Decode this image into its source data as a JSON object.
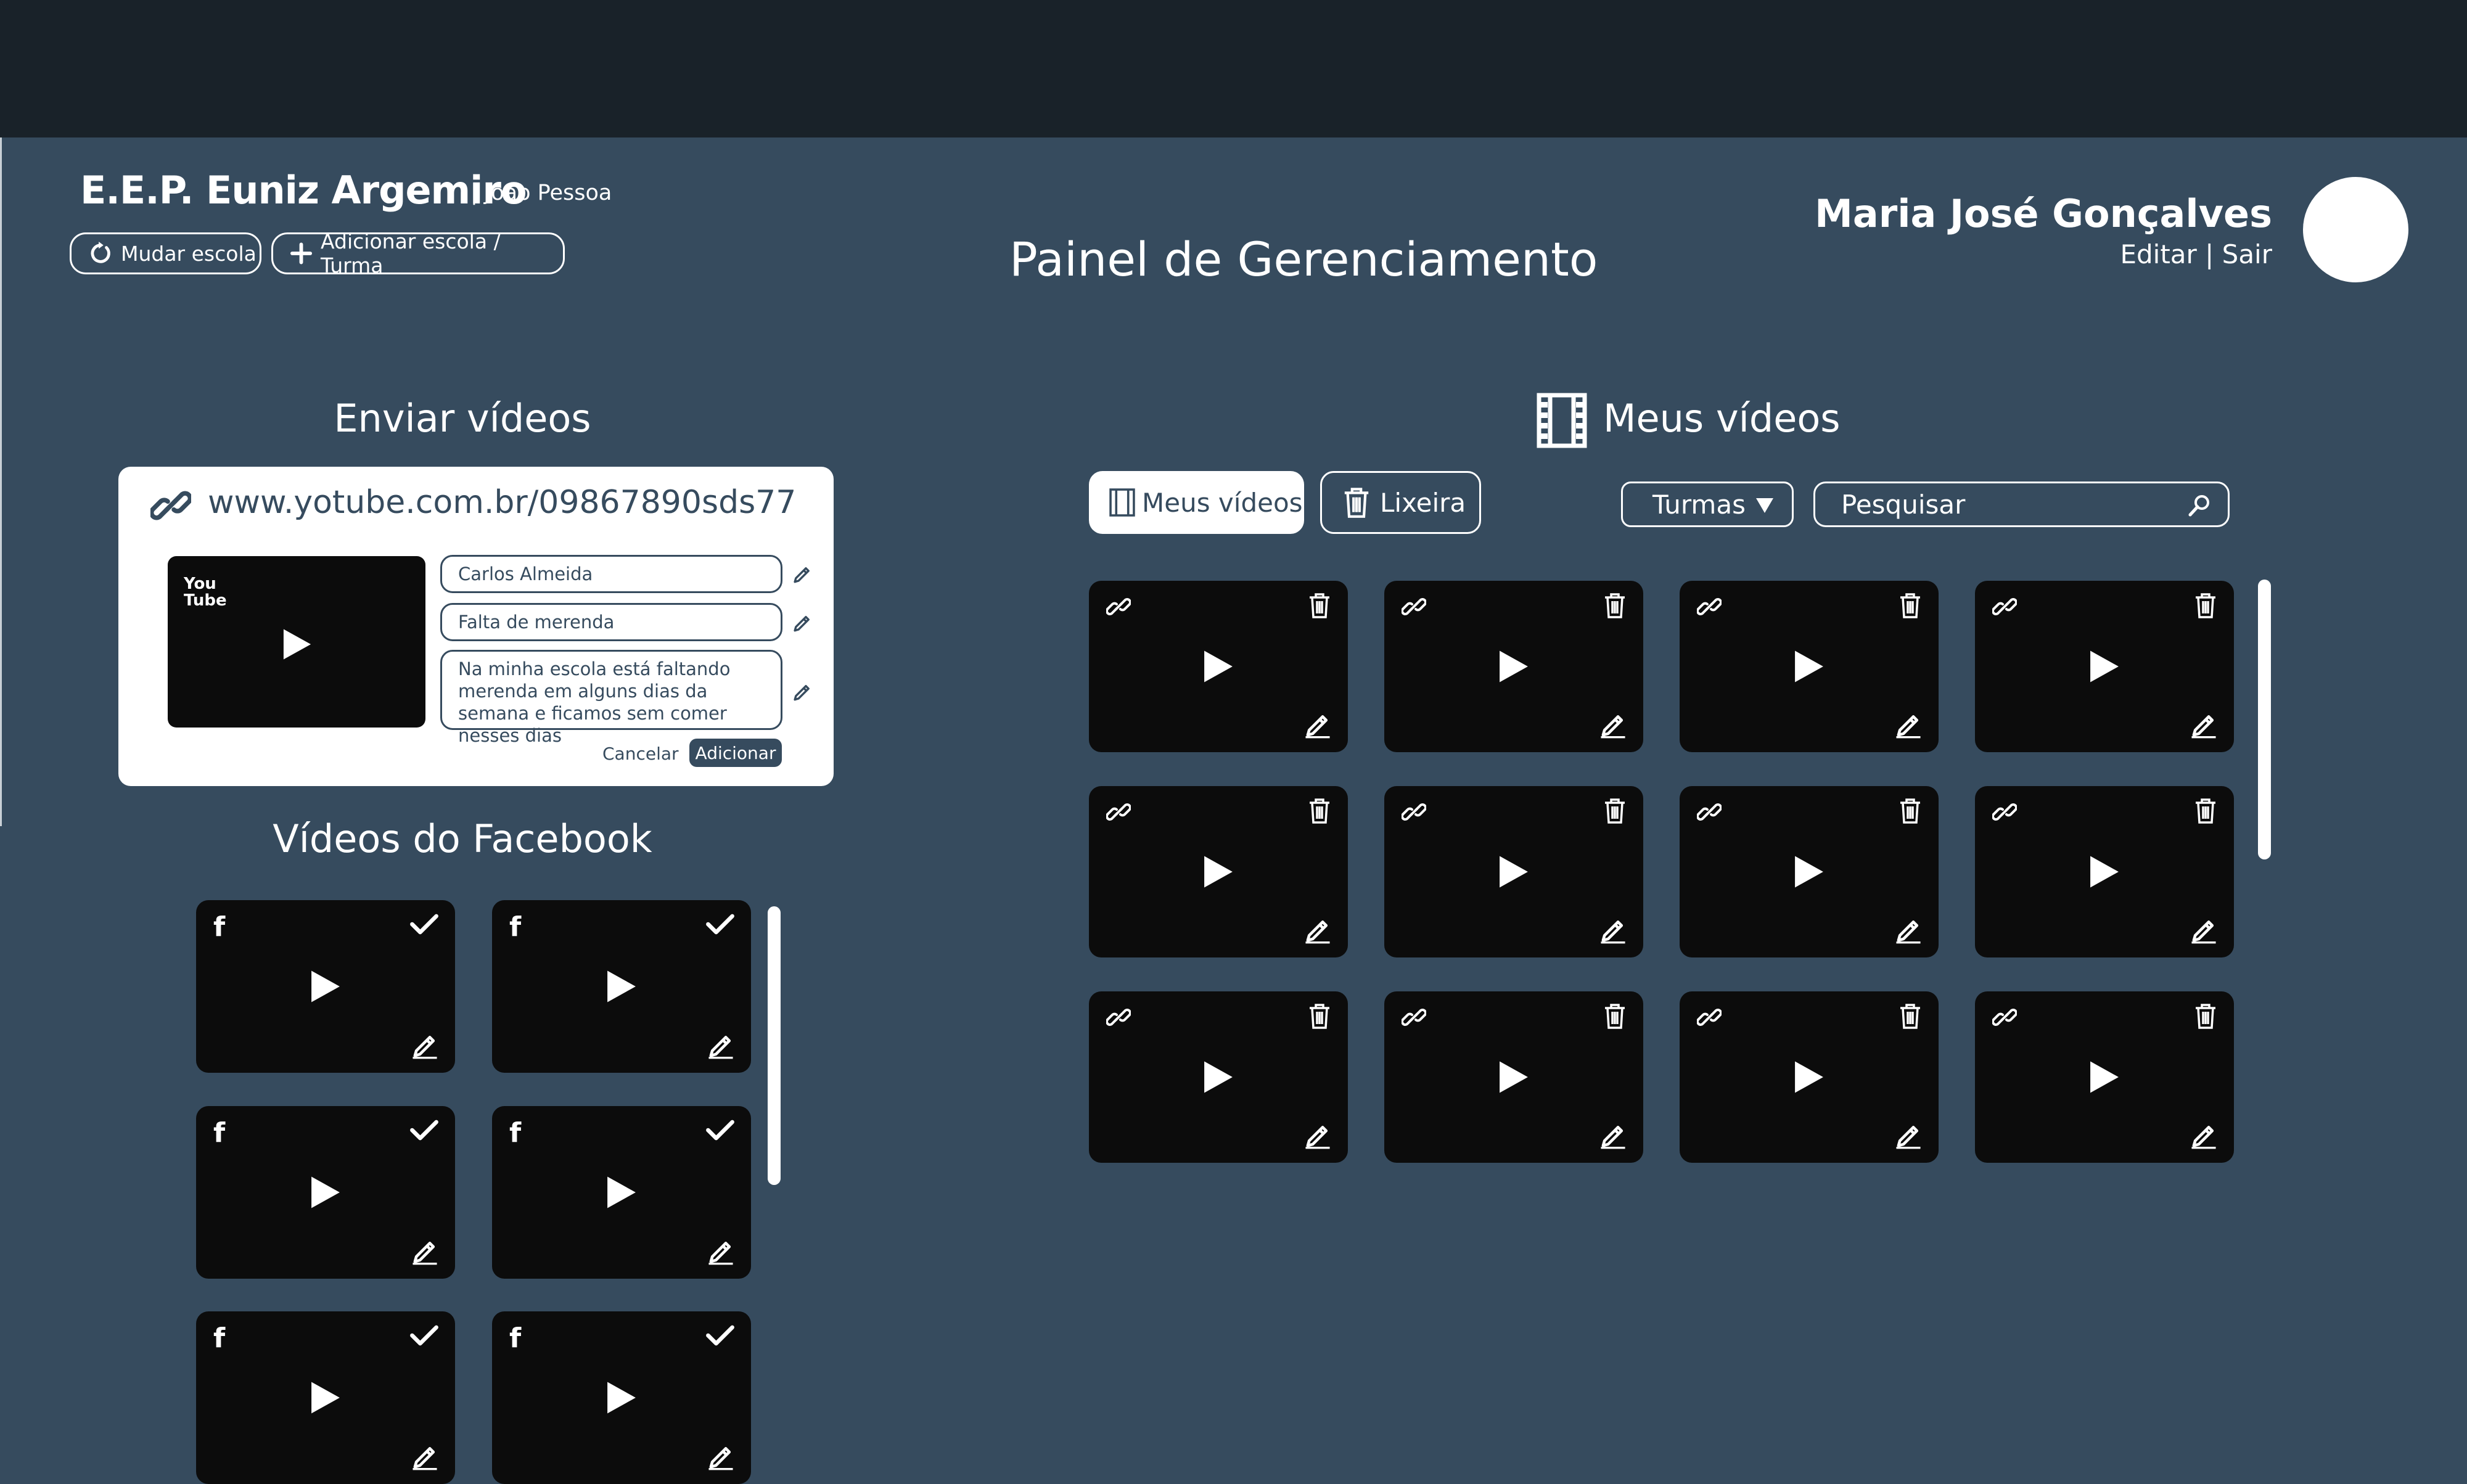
{
  "header": {
    "school_name": "E.E.P. Euniz Argemiro",
    "school_city": "| João Pessoa",
    "change_school": "Mudar escola",
    "add_school": "Adicionar escola / Turma",
    "panel_title": "Painel de Gerenciamento",
    "user_name": "Maria José Gonçalves",
    "user_links": "Editar | Sair"
  },
  "upload": {
    "title": "Enviar vídeos",
    "url": "www.yotube.com.br/09867890sds77",
    "thumb_logo": "You\nTube",
    "author": "Carlos Almeida",
    "subject": "Falta de merenda",
    "description": "Na minha escola está faltando merenda em alguns dias da semana e ficamos sem comer nesses dias",
    "cancel": "Cancelar",
    "add": "Adicionar"
  },
  "facebook": {
    "title": "Vídeos do Facebook",
    "badge": "f",
    "videos": 6
  },
  "my_videos": {
    "title": "Meus vídeos",
    "tab_my_videos": "Meus vídeos",
    "tab_trash": "Lixeira",
    "filter": "Turmas",
    "search_placeholder": "Pesquisar",
    "videos": 12
  },
  "colors": {
    "background": "#364b5e",
    "topbar": "#192229",
    "thumbnail": "#0c0c0c",
    "white": "#ffffff"
  },
  "icons": [
    "refresh-icon",
    "plus-icon",
    "link-icon",
    "pencil-icon",
    "play-icon",
    "check-icon",
    "trash-icon",
    "film-icon",
    "search-icon",
    "caret-down-icon"
  ]
}
